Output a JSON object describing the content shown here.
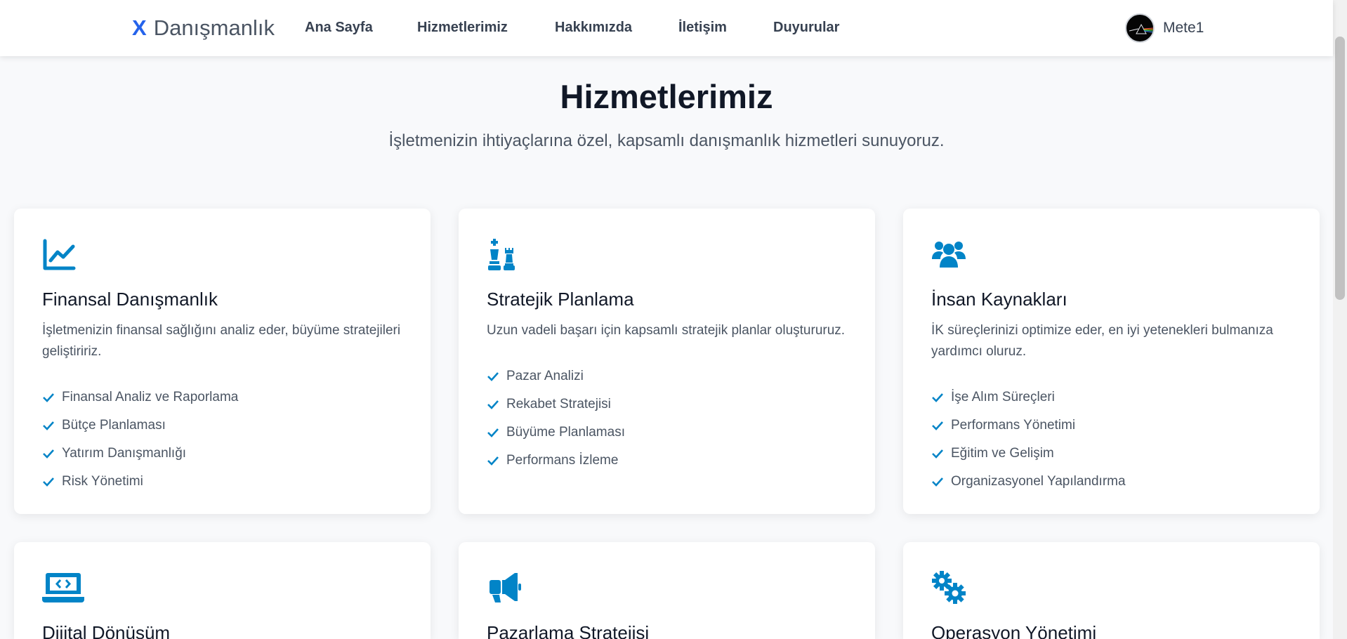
{
  "nav": {
    "brand_mark": "X",
    "brand_text": "Danışmanlık",
    "links": [
      "Ana Sayfa",
      "Hizmetlerimiz",
      "Hakkımızda",
      "İletişim",
      "Duyurular"
    ],
    "user_name": "Mete1"
  },
  "header": {
    "title": "Hizmetlerimiz",
    "subtitle": "İşletmenizin ihtiyaçlarına özel, kapsamlı danışmanlık hizmetleri sunuyoruz."
  },
  "services": [
    {
      "icon": "chart-line-icon",
      "title": "Finansal Danışmanlık",
      "description": "İşletmenizin finansal sağlığını analiz eder, büyüme stratejileri geliştiririz.",
      "items": [
        "Finansal Analiz ve Raporlama",
        "Bütçe Planlaması",
        "Yatırım Danışmanlığı",
        "Risk Yönetimi"
      ]
    },
    {
      "icon": "chess-icon",
      "title": "Stratejik Planlama",
      "description": "Uzun vadeli başarı için kapsamlı stratejik planlar oluştururuz.",
      "items": [
        "Pazar Analizi",
        "Rekabet Stratejisi",
        "Büyüme Planlaması",
        "Performans İzleme"
      ]
    },
    {
      "icon": "users-icon",
      "title": "İnsan Kaynakları",
      "description": "İK süreçlerinizi optimize eder, en iyi yetenekleri bulmanıza yardımcı oluruz.",
      "items": [
        "İşe Alım Süreçleri",
        "Performans Yönetimi",
        "Eğitim ve Gelişim",
        "Organizasyonel Yapılandırma"
      ]
    },
    {
      "icon": "laptop-code-icon",
      "title": "Dijital Dönüşüm"
    },
    {
      "icon": "bullhorn-icon",
      "title": "Pazarlama Stratejisi"
    },
    {
      "icon": "gears-icon",
      "title": "Operasyon Yönetimi"
    }
  ],
  "colors": {
    "accent": "#0284c7",
    "brand": "#2563eb",
    "background": "#f8f9fb"
  }
}
